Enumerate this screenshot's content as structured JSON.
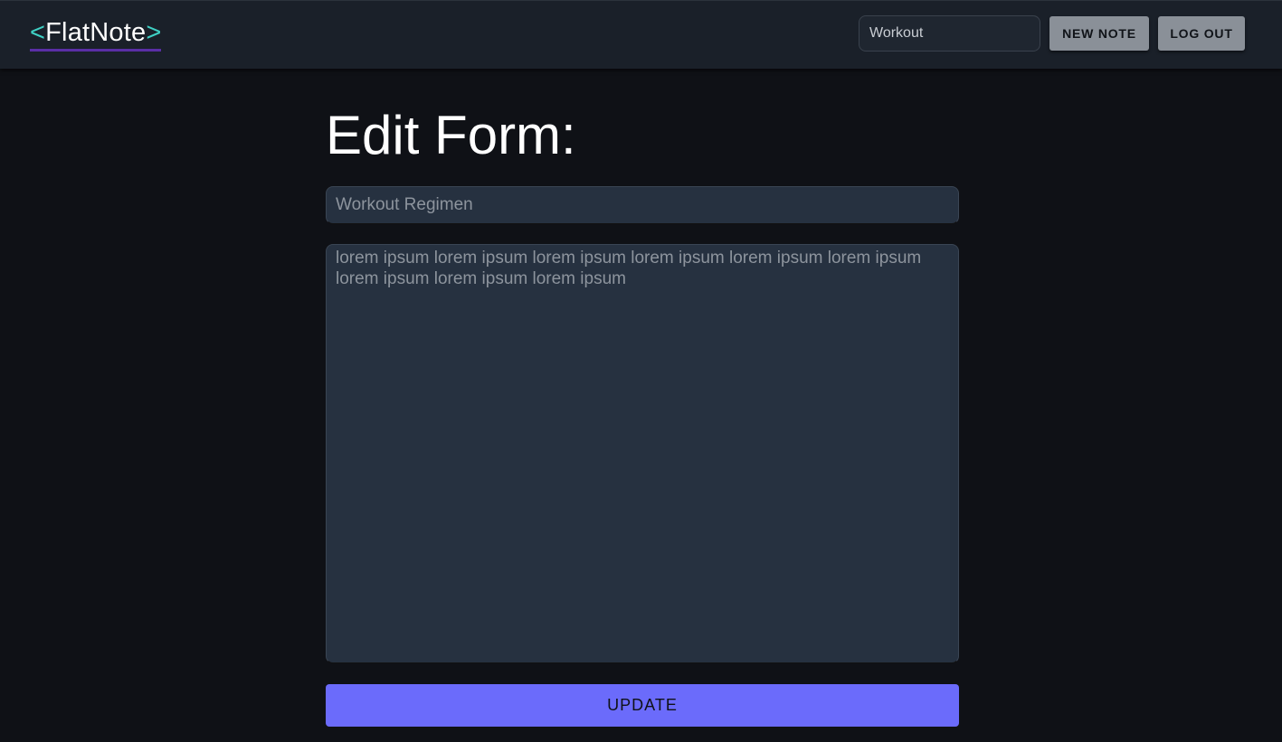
{
  "header": {
    "logo_open": "<",
    "logo_name": "FlatNote",
    "logo_close": ">",
    "search_value": "Workout",
    "new_note_label": "NEW NOTE",
    "logout_label": "LOG OUT"
  },
  "form": {
    "heading": "Edit Form:",
    "title_placeholder": "Workout Regimen",
    "body_placeholder": "lorem ipsum lorem ipsum lorem ipsum lorem ipsum lorem ipsum lorem ipsum lorem ipsum lorem ipsum lorem ipsum",
    "update_label": "UPDATE"
  },
  "colors": {
    "background": "#0f1116",
    "appbar": "#1a2029",
    "accent_button": "#6b6bfb",
    "logo_bracket": "#3fd0c4",
    "logo_underline": "#5a2ea6"
  }
}
